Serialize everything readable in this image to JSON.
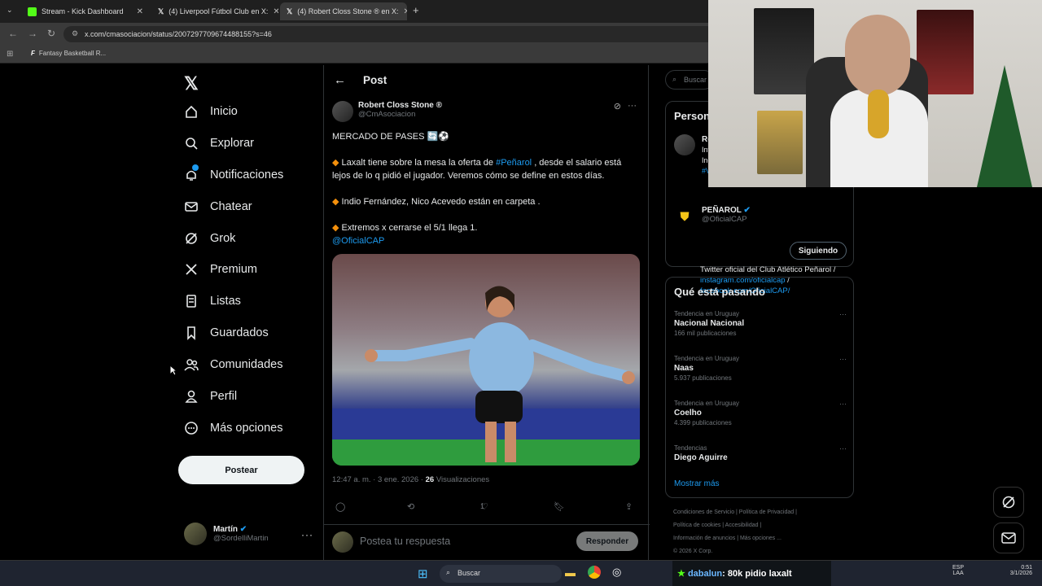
{
  "browser": {
    "tabs": [
      {
        "title": "Stream - Kick Dashboard",
        "favicon_color": "#53fc18"
      },
      {
        "title": "(4) Liverpool Fútbol Club en X:",
        "favicon_color": "#ffffff"
      },
      {
        "title": "(4) Robert Closs Stone ® en X:",
        "favicon_color": "#ffffff"
      }
    ],
    "url": "x.com/cmasociacion/status/2007297709674488155?s=46",
    "bookmark": "Fantasy Basketball R..."
  },
  "nav": {
    "items": [
      {
        "label": "Inicio",
        "icon": "home-icon"
      },
      {
        "label": "Explorar",
        "icon": "search-icon"
      },
      {
        "label": "Notificaciones",
        "icon": "bell-icon"
      },
      {
        "label": "Chatear",
        "icon": "mail-icon"
      },
      {
        "label": "Grok",
        "icon": "grok-icon"
      },
      {
        "label": "Premium",
        "icon": "x-icon"
      },
      {
        "label": "Listas",
        "icon": "list-icon"
      },
      {
        "label": "Guardados",
        "icon": "bookmark-icon"
      },
      {
        "label": "Comunidades",
        "icon": "people-icon"
      },
      {
        "label": "Perfil",
        "icon": "person-icon"
      },
      {
        "label": "Más opciones",
        "icon": "more-circle-icon"
      }
    ],
    "post_button": "Postear",
    "user": {
      "name": "Martín",
      "handle": "@SordelliMartin"
    }
  },
  "post": {
    "header": "Post",
    "author_name": "Robert Closs Stone ®",
    "author_handle": "@CmAsociacion",
    "line1": "MERCADO DE PASES 🔄⚽",
    "p1_pre": "Laxalt tiene sobre la mesa la oferta de ",
    "p1_link": "#Peñarol",
    "p1_post": " , desde el salario está lejos de lo q pidió el jugador. Veremos cómo se define en estos días.",
    "p2": "Indio Fernández, Nico Acevedo están en carpeta .",
    "p3": "Extremos x cerrarse el 5/1 llega 1.",
    "mention": "@OficialCAP",
    "time": "12:47 a. m. · 3 ene. 2026 · ",
    "views": "26",
    "views_label": " Visualizaciones",
    "likes": "1",
    "reply_placeholder": "Postea tu respuesta",
    "reply_button": "Responder"
  },
  "right": {
    "search_placeholder": "Buscar",
    "who_title": "Person",
    "who_partial": {
      "name": "Ro",
      "line1": "Int",
      "line2": "Inc",
      "line3": "#V"
    },
    "account": {
      "name": "PEÑAROL",
      "handle": "@OficialCAP",
      "follow": "Siguiendo",
      "bio_text": "Twitter oficial del Club Atlético Peñarol / ",
      "bio_link1": "instagram.com/oficialcap",
      "bio_sep": " / ",
      "bio_link2": "facebook.com/OficialCAP/"
    },
    "trends_title": "Qué está pasando",
    "trends": [
      {
        "context": "Tendencia en Uruguay",
        "name": "Nacional Nacional",
        "count": "166 mil publicaciones"
      },
      {
        "context": "Tendencia en Uruguay",
        "name": "Naas",
        "count": "5.937 publicaciones"
      },
      {
        "context": "Tendencia en Uruguay",
        "name": "Coelho",
        "count": "4.399 publicaciones"
      },
      {
        "context": "Tendencias",
        "name": "Diego Aguirre",
        "count": ""
      }
    ],
    "show_more": "Mostrar más",
    "footer": [
      "Condiciones de Servicio  |  Política de Privacidad  |",
      "Política de cookies  |  Accesibilidad  |",
      "Información de anuncios  |  Más opciones ...",
      "© 2026 X Corp."
    ]
  },
  "taskbar": {
    "search": "Buscar",
    "chat_user": "dabalun",
    "chat_msg": ": 80k pidio laxalt",
    "lang1": "ESP",
    "lang2": "LAA",
    "time": "0:51",
    "date": "3/1/2026"
  }
}
